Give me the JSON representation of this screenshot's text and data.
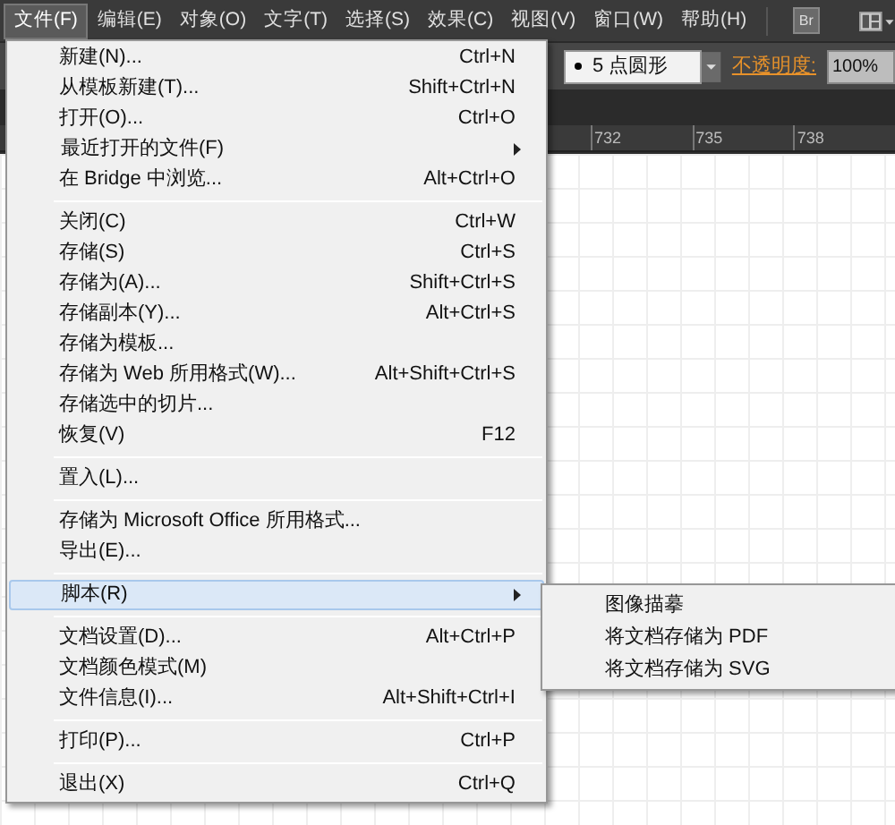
{
  "menubar": [
    {
      "label": "文件(F)",
      "selected": true
    },
    {
      "label": "编辑(E)",
      "selected": false
    },
    {
      "label": "对象(O)",
      "selected": false
    },
    {
      "label": "文字(T)",
      "selected": false
    },
    {
      "label": "选择(S)",
      "selected": false
    },
    {
      "label": "效果(C)",
      "selected": false
    },
    {
      "label": "视图(V)",
      "selected": false
    },
    {
      "label": "窗口(W)",
      "selected": false
    },
    {
      "label": "帮助(H)",
      "selected": false
    }
  ],
  "app_bar": {
    "bridge_button": "Br"
  },
  "control_bar": {
    "brush": "5 点圆形",
    "opacity_label": "不透明度:",
    "opacity_value": "100%"
  },
  "ruler": [
    "732",
    "735",
    "738"
  ],
  "file_menu": [
    {
      "kind": "item",
      "label": "新建(N)...",
      "shortcut": "Ctrl+N"
    },
    {
      "kind": "item",
      "label": "从模板新建(T)...",
      "shortcut": "Shift+Ctrl+N"
    },
    {
      "kind": "item",
      "label": "打开(O)...",
      "shortcut": "Ctrl+O"
    },
    {
      "kind": "submenu",
      "label": "最近打开的文件(F)",
      "selected": false
    },
    {
      "kind": "item",
      "label": "在 Bridge 中浏览...",
      "shortcut": "Alt+Ctrl+O"
    },
    {
      "kind": "separator"
    },
    {
      "kind": "item",
      "label": "关闭(C)",
      "shortcut": "Ctrl+W"
    },
    {
      "kind": "item",
      "label": "存储(S)",
      "shortcut": "Ctrl+S"
    },
    {
      "kind": "item",
      "label": "存储为(A)...",
      "shortcut": "Shift+Ctrl+S"
    },
    {
      "kind": "item",
      "label": "存储副本(Y)...",
      "shortcut": "Alt+Ctrl+S"
    },
    {
      "kind": "item",
      "label": "存储为模板..."
    },
    {
      "kind": "item",
      "label": "存储为 Web 所用格式(W)...",
      "shortcut": "Alt+Shift+Ctrl+S"
    },
    {
      "kind": "item",
      "label": "存储选中的切片..."
    },
    {
      "kind": "item",
      "label": "恢复(V)",
      "shortcut": "F12"
    },
    {
      "kind": "separator"
    },
    {
      "kind": "item",
      "label": "置入(L)..."
    },
    {
      "kind": "separator"
    },
    {
      "kind": "item",
      "label": "存储为 Microsoft Office 所用格式..."
    },
    {
      "kind": "item",
      "label": "导出(E)..."
    },
    {
      "kind": "separator"
    },
    {
      "kind": "submenu",
      "label": "脚本(R)",
      "selected": true
    },
    {
      "kind": "separator"
    },
    {
      "kind": "item",
      "label": "文档设置(D)...",
      "shortcut": "Alt+Ctrl+P"
    },
    {
      "kind": "item",
      "label": "文档颜色模式(M)"
    },
    {
      "kind": "item",
      "label": "文件信息(I)...",
      "shortcut": "Alt+Shift+Ctrl+I"
    },
    {
      "kind": "separator"
    },
    {
      "kind": "item",
      "label": "打印(P)...",
      "shortcut": "Ctrl+P"
    },
    {
      "kind": "separator"
    },
    {
      "kind": "item",
      "label": "退出(X)",
      "shortcut": "Ctrl+Q"
    }
  ],
  "scripts_submenu": [
    "图像描摹",
    "将文档存储为 PDF",
    "将文档存储为 SVG"
  ]
}
